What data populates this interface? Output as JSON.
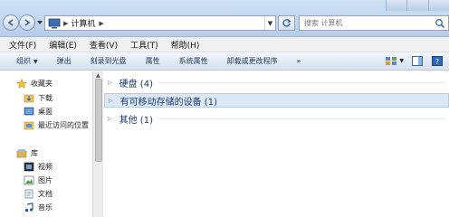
{
  "window": {
    "address_segment": "计算机",
    "search_placeholder": "搜索 计算机"
  },
  "menu": {
    "items": [
      "文件(F)",
      "编辑(E)",
      "查看(V)",
      "工具(T)",
      "帮助(H)"
    ]
  },
  "toolbar": {
    "organize": "组织",
    "eject": "弹出",
    "burn": "刻录到光盘",
    "properties": "属性",
    "system_properties": "系统属性",
    "uninstall": "卸载或更改程序",
    "more": "»"
  },
  "nav": {
    "favorites": "收藏夹",
    "downloads": "下载",
    "desktop": "桌面",
    "recent": "最近访问的位置",
    "libraries": "库",
    "videos": "视频",
    "pictures": "图片",
    "documents": "文档",
    "music": "音乐"
  },
  "content": {
    "groups": [
      {
        "label": "硬盘 (4)"
      },
      {
        "label": "有可移动存储的设备 (1)"
      },
      {
        "label": "其他 (1)"
      }
    ]
  }
}
